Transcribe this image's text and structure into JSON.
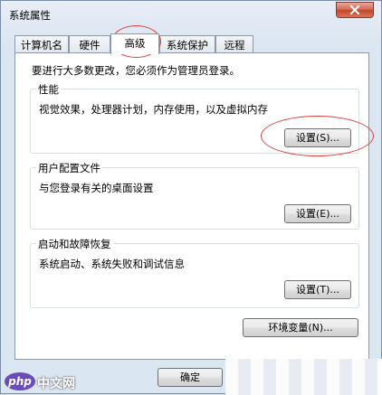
{
  "window": {
    "title": "系统属性"
  },
  "tabs": [
    {
      "label": "计算机名",
      "active": false
    },
    {
      "label": "硬件",
      "active": false
    },
    {
      "label": "高级",
      "active": true
    },
    {
      "label": "系统保护",
      "active": false
    },
    {
      "label": "远程",
      "active": false
    }
  ],
  "notice": "要进行大多数更改，您必须作为管理员登录。",
  "groups": {
    "performance": {
      "title": "性能",
      "description": "视觉效果，处理器计划，内存使用，以及虚拟内存",
      "button": "设置(S)..."
    },
    "user_profiles": {
      "title": "用户配置文件",
      "description": "与您登录有关的桌面设置",
      "button": "设置(E)..."
    },
    "startup_recovery": {
      "title": "启动和故障恢复",
      "description": "系统启动、系统失败和调试信息",
      "button": "设置(T)..."
    }
  },
  "env_button": "环境变量(N)...",
  "ok_button": "确定",
  "watermark": {
    "logo": "php",
    "text": "中文网"
  },
  "icons": {
    "close": "close-icon"
  },
  "colors": {
    "annotation": "#d9403b",
    "close_button": "#c2452b"
  }
}
